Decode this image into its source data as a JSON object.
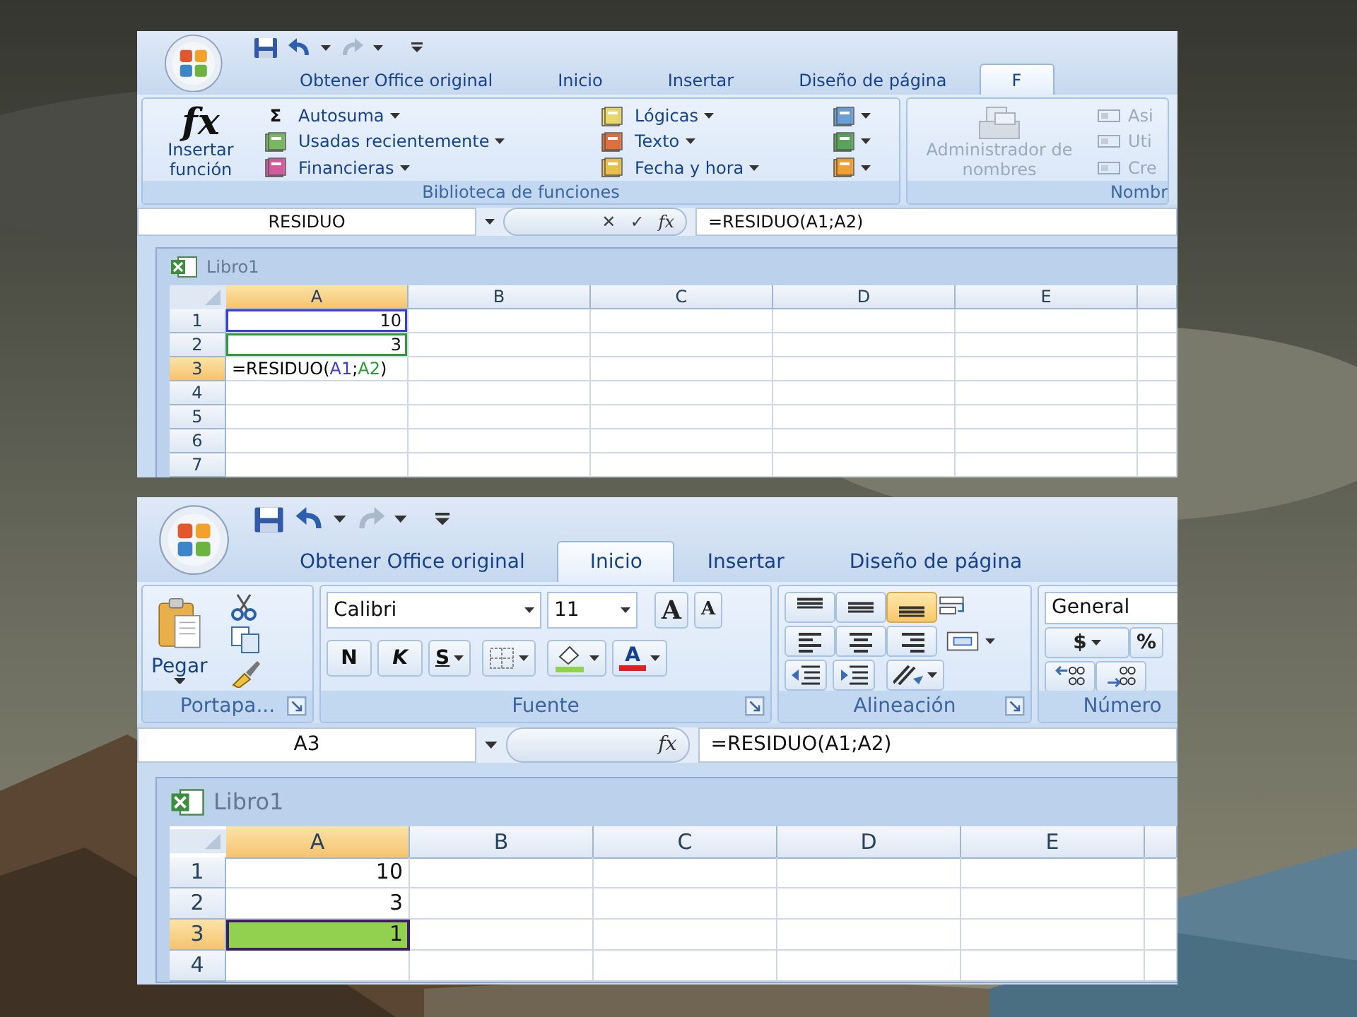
{
  "screenshots": [
    {
      "tabs": [
        {
          "label": "Obtener Office original",
          "selected": false
        },
        {
          "label": "Inicio",
          "selected": false
        },
        {
          "label": "Insertar",
          "selected": false
        },
        {
          "label": "Diseño de página",
          "selected": false
        },
        {
          "label": "F",
          "selected": true
        }
      ],
      "ribbon": {
        "kind": "formulas",
        "groups": [
          {
            "title": "Biblioteca de funciones",
            "symbol": "fx",
            "items": [
              {
                "label": "Insertar función",
                "disabled": false
              },
              {
                "label": "Autosuma",
                "symbol": "Σ",
                "disabled": false
              },
              {
                "label": "Usadas recientemente",
                "disabled": false
              },
              {
                "label": "Financieras",
                "disabled": false
              },
              {
                "label": "Lógicas",
                "disabled": false
              },
              {
                "label": "Texto",
                "disabled": false
              },
              {
                "label": "Fecha y hora",
                "disabled": false
              }
            ]
          },
          {
            "title": "Nombr",
            "items": [
              {
                "label": "Administrador de nombres",
                "disabled": true
              },
              {
                "label": "Asi",
                "disabled": true
              },
              {
                "label": "Uti",
                "disabled": true
              },
              {
                "label": "Cre",
                "disabled": true
              }
            ]
          }
        ]
      },
      "formula_bar": {
        "name_box": "RESIDUO",
        "buttons": [
          "✕",
          "✓"
        ],
        "function_symbol": "fx",
        "formula": "=RESIDUO(A1;A2)"
      },
      "workbook": {
        "title": "Libro1",
        "columns": [
          {
            "label": "A",
            "selected": true
          },
          {
            "label": "B",
            "selected": false
          },
          {
            "label": "C",
            "selected": false
          },
          {
            "label": "D",
            "selected": false
          },
          {
            "label": "E",
            "selected": false
          }
        ],
        "rows": [
          {
            "header": "1",
            "selected": false,
            "cells": [
              {
                "value": "10",
                "kind": "reference",
                "color": "#3c3cd8",
                "selected": false
              }
            ]
          },
          {
            "header": "2",
            "selected": false,
            "cells": [
              {
                "value": "3",
                "kind": "reference",
                "color": "#2f9a3a",
                "selected": false
              }
            ]
          },
          {
            "header": "3",
            "selected": true,
            "cells": [
              {
                "segments": [
                  {
                    "text": "=RESIDUO(",
                    "color": "#000000"
                  },
                  {
                    "text": "A1",
                    "color": "#3c3cd8"
                  },
                  {
                    "text": ";",
                    "color": "#000000"
                  },
                  {
                    "text": "A2",
                    "color": "#2f9a3a"
                  },
                  {
                    "text": ")",
                    "color": "#000000"
                  }
                ],
                "selected": false
              }
            ]
          },
          {
            "header": "4",
            "selected": false,
            "cells": []
          },
          {
            "header": "5",
            "selected": false,
            "cells": []
          },
          {
            "header": "6",
            "selected": false,
            "cells": []
          },
          {
            "header": "7",
            "selected": false,
            "cells": []
          }
        ]
      }
    },
    {
      "tabs": [
        {
          "label": "Obtener Office original",
          "selected": false
        },
        {
          "label": "Inicio",
          "selected": true
        },
        {
          "label": "Insertar",
          "selected": false
        },
        {
          "label": "Diseño de página",
          "selected": false
        }
      ],
      "ribbon": {
        "kind": "home",
        "groups": [
          {
            "title": "Portapa...",
            "launcher": true,
            "items": [
              {
                "label": "Pegar"
              }
            ]
          },
          {
            "title": "Fuente",
            "launcher": true,
            "font": "Calibri",
            "size": "11",
            "items": [
              {
                "label": "A"
              },
              {
                "label": "A"
              },
              {
                "label": "N"
              },
              {
                "label": "K"
              },
              {
                "label": "S"
              },
              {
                "label": "A"
              }
            ]
          },
          {
            "title": "Alineación",
            "launcher": true,
            "vertical_align": [
              {
                "selected": false
              },
              {
                "selected": false
              },
              {
                "selected": true
              }
            ]
          },
          {
            "title": "Número",
            "format": "General",
            "items": [
              {
                "label": "$"
              },
              {
                "label": "%"
              }
            ]
          }
        ]
      },
      "formula_bar": {
        "name_box": "A3",
        "function_symbol": "fx",
        "formula": "=RESIDUO(A1;A2)"
      },
      "workbook": {
        "title": "Libro1",
        "columns": [
          {
            "label": "A",
            "selected": true
          },
          {
            "label": "B",
            "selected": false
          },
          {
            "label": "C",
            "selected": false
          },
          {
            "label": "D",
            "selected": false
          },
          {
            "label": "E",
            "selected": false
          }
        ],
        "rows": [
          {
            "header": "1",
            "selected": false,
            "cells": [
              {
                "value": "10",
                "selected": false
              }
            ]
          },
          {
            "header": "2",
            "selected": false,
            "cells": [
              {
                "value": "3",
                "selected": false
              }
            ]
          },
          {
            "header": "3",
            "selected": true,
            "cells": [
              {
                "value": "1",
                "selected": true,
                "kind": "fill",
                "color": "#92d050"
              }
            ]
          },
          {
            "header": "4",
            "selected": false,
            "cells": []
          }
        ]
      }
    }
  ]
}
